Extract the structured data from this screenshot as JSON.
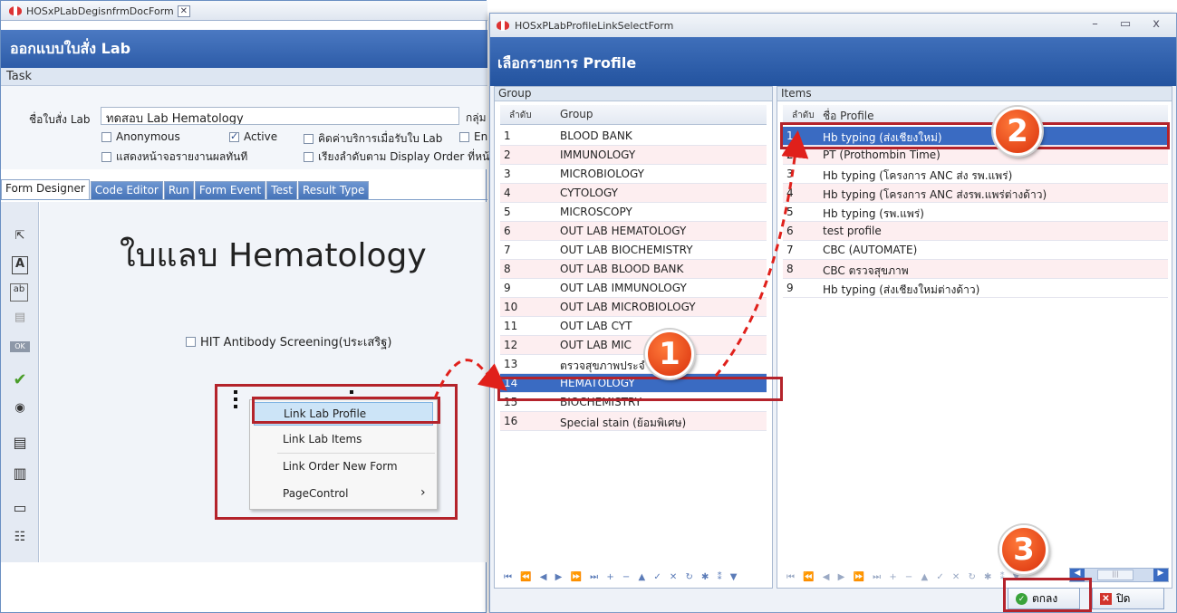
{
  "left_window": {
    "tab_title": "HOSxPLabDegisnfrmDocForm",
    "tab_close": "✕",
    "header_title": "ออกแบบใบสั่ง Lab",
    "task_label": "Task",
    "form": {
      "name_label": "ชื่อใบสั่ง Lab",
      "name_value": "ทดสอบ Lab Hematology",
      "group_label": "กลุ่ม",
      "checkboxes": {
        "anonymous": "Anonymous",
        "active": "Active",
        "charge": "คิดค่าบริการเมื่อรับใบ Lab",
        "en": "En",
        "show_report": "แสดงหน้าจอรายงานผลทันที",
        "display_order": "เรียงลำดับตาม Display Order ที่หน้าจ"
      }
    },
    "designer_tabs": [
      "Form Designer",
      "Code Editor",
      "Run",
      "Form Event",
      "Test",
      "Result Type"
    ],
    "canvas_title": "ใบแลบ Hematology",
    "hit_checkbox": "HIT Antibody Screening(ประเสริฐ)",
    "context_menu": [
      "Link Lab Profile",
      "Link Lab Items",
      "Link Order New Form",
      "PageControl"
    ],
    "submenu_arrow": "›"
  },
  "dialog": {
    "window_title": "HOSxPLabProfileLinkSelectForm",
    "window_controls": "– ▭ x",
    "header_title": "เลือกรายการ Profile",
    "group_panel": {
      "title": "Group",
      "col_no": "ลำดับ",
      "col_name": "Group",
      "rows": [
        {
          "no": "1",
          "name": "BLOOD BANK"
        },
        {
          "no": "2",
          "name": "IMMUNOLOGY"
        },
        {
          "no": "3",
          "name": "MICROBIOLOGY"
        },
        {
          "no": "4",
          "name": "CYTOLOGY"
        },
        {
          "no": "5",
          "name": "MICROSCOPY"
        },
        {
          "no": "6",
          "name": "OUT LAB HEMATOLOGY"
        },
        {
          "no": "7",
          "name": "OUT LAB BIOCHEMISTRY"
        },
        {
          "no": "8",
          "name": "OUT LAB BLOOD BANK"
        },
        {
          "no": "9",
          "name": "OUT LAB IMMUNOLOGY"
        },
        {
          "no": "10",
          "name": "OUT LAB MICROBIOLOGY"
        },
        {
          "no": "11",
          "name": "OUT LAB CYT"
        },
        {
          "no": "12",
          "name": "OUT LAB MIC"
        },
        {
          "no": "13",
          "name": "ตรวจสุขภาพประจำปี"
        },
        {
          "no": "14",
          "name": "HEMATOLOGY"
        },
        {
          "no": "15",
          "name": "BIOCHEMISTRY"
        },
        {
          "no": "16",
          "name": "Special stain (ย้อมพิเศษ)"
        }
      ]
    },
    "items_panel": {
      "title": "Items",
      "col_no": "ลำดับ",
      "col_name": "ชื่อ Profile",
      "rows": [
        {
          "no": "1",
          "name": "Hb typing (ส่งเชียงใหม่)"
        },
        {
          "no": "2",
          "name": "PT (Prothombin Time)"
        },
        {
          "no": "3",
          "name": "Hb typing (โครงการ ANC ส่ง รพ.แพร่)"
        },
        {
          "no": "4",
          "name": "Hb typing (โครงการ ANC ส่งรพ.แพร่ต่างด้าว)"
        },
        {
          "no": "5",
          "name": "Hb typing (รพ.แพร่)"
        },
        {
          "no": "6",
          "name": "test profile"
        },
        {
          "no": "7",
          "name": "CBC (AUTOMATE)"
        },
        {
          "no": "8",
          "name": "CBC ตรวจสุขภาพ"
        },
        {
          "no": "9",
          "name": "Hb typing (ส่งเชียงใหม่ต่างด้าว)"
        }
      ]
    },
    "navigator": "⏮ ⏪ ◀ ▶ ⏩ ⏭ + − ▲ ✓ ✕ ↻ ✱ ⁑ ▼",
    "scroll_thumb": "|||",
    "ok_button": "ตกลง",
    "close_button": "ปิด"
  },
  "callouts": [
    "1",
    "2",
    "3"
  ],
  "colors": {
    "title_blue": "#2d5ca8",
    "selection": "#3a6bc2",
    "highlight_red": "#b4232b",
    "callout_orange": "#e8451a"
  }
}
